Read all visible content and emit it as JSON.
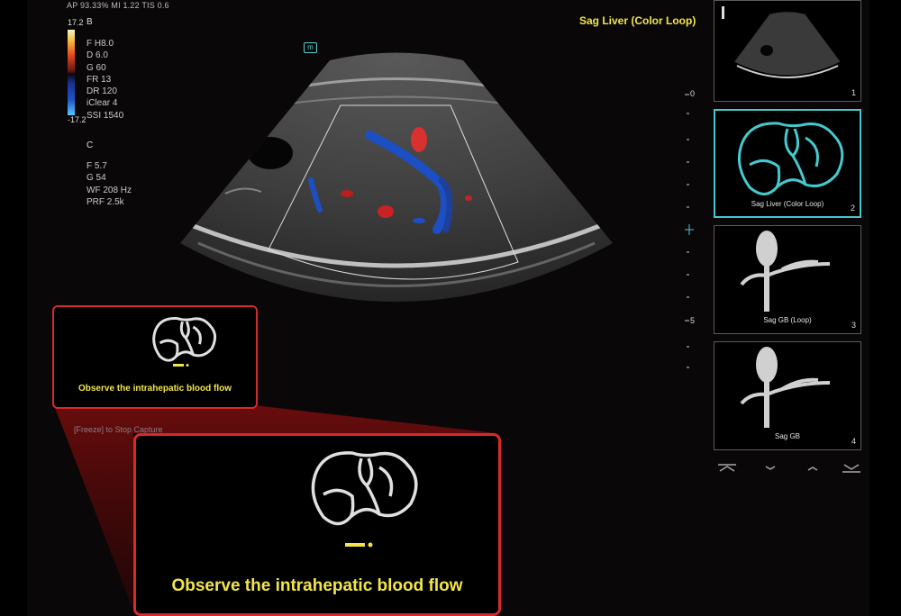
{
  "header": {
    "info": "AP 93.33%  MI 1.22  TIS 0.6",
    "mode_title": "Sag Liver (Color Loop)"
  },
  "color_bar": {
    "top_value": "17.2",
    "bottom_value": "-17.2"
  },
  "section_b": {
    "title": "B",
    "params": [
      "F H8.0",
      "D 6.0",
      "G 60",
      "FR 13",
      "DR 120",
      "iClear 4",
      "SSI 1540"
    ]
  },
  "section_c": {
    "title": "C",
    "params": [
      "F 5.7",
      "G 54",
      "WF 208 Hz",
      "PRF 2.5k"
    ]
  },
  "m_badge": "m",
  "depth_scale": {
    "top": "0",
    "middle": "5"
  },
  "thumbnails": [
    {
      "label": "",
      "number": "1",
      "active": false
    },
    {
      "label": "Sag Liver (Color Loop)",
      "number": "2",
      "active": true
    },
    {
      "label": "Sag GB (Loop)",
      "number": "3",
      "active": false
    },
    {
      "label": "Sag GB",
      "number": "4",
      "active": false
    }
  ],
  "freeze_hint": "[Freeze] to Stop Capture",
  "callout": {
    "caption": "Observe the intrahepatic blood flow"
  },
  "colors": {
    "accent_yellow": "#f2e54a",
    "callout_red": "#d52a2a",
    "active_cyan": "#45c9cf"
  },
  "icons": [
    "liver-icon",
    "gallbladder-icon",
    "scroll-arrow-icon"
  ]
}
